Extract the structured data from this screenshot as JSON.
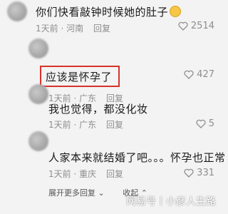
{
  "comments": [
    {
      "text": "你们快看敲钟时候她的肚子",
      "time": "1天前",
      "location": "河南",
      "reply": "回复",
      "likes": "2514"
    },
    {
      "text": "应该是怀孕了",
      "time": "1天前",
      "location": "广东",
      "reply": "回复",
      "likes": "427"
    },
    {
      "text": "我也觉得，都没化妆",
      "time": "1天前",
      "location": "广东",
      "reply": "回复",
      "likes": "5"
    },
    {
      "text": "人家本来就结婚了吧。。。怀孕也正常",
      "time": "1天前",
      "location": "重庆",
      "reply": "回复",
      "likes": "331"
    }
  ],
  "thread": {
    "expand_label": "展开更多回复",
    "collapse_label": "收起"
  },
  "watermark": "网易号丨小彦人生路",
  "colors": {
    "highlight": "#d6332b",
    "meta": "#8e8e8e"
  },
  "icons": {
    "like": "heart-outline-icon",
    "emoji": "smiling-face-icon",
    "expand": "chevron-down-icon",
    "collapse": "chevron-up-icon"
  }
}
